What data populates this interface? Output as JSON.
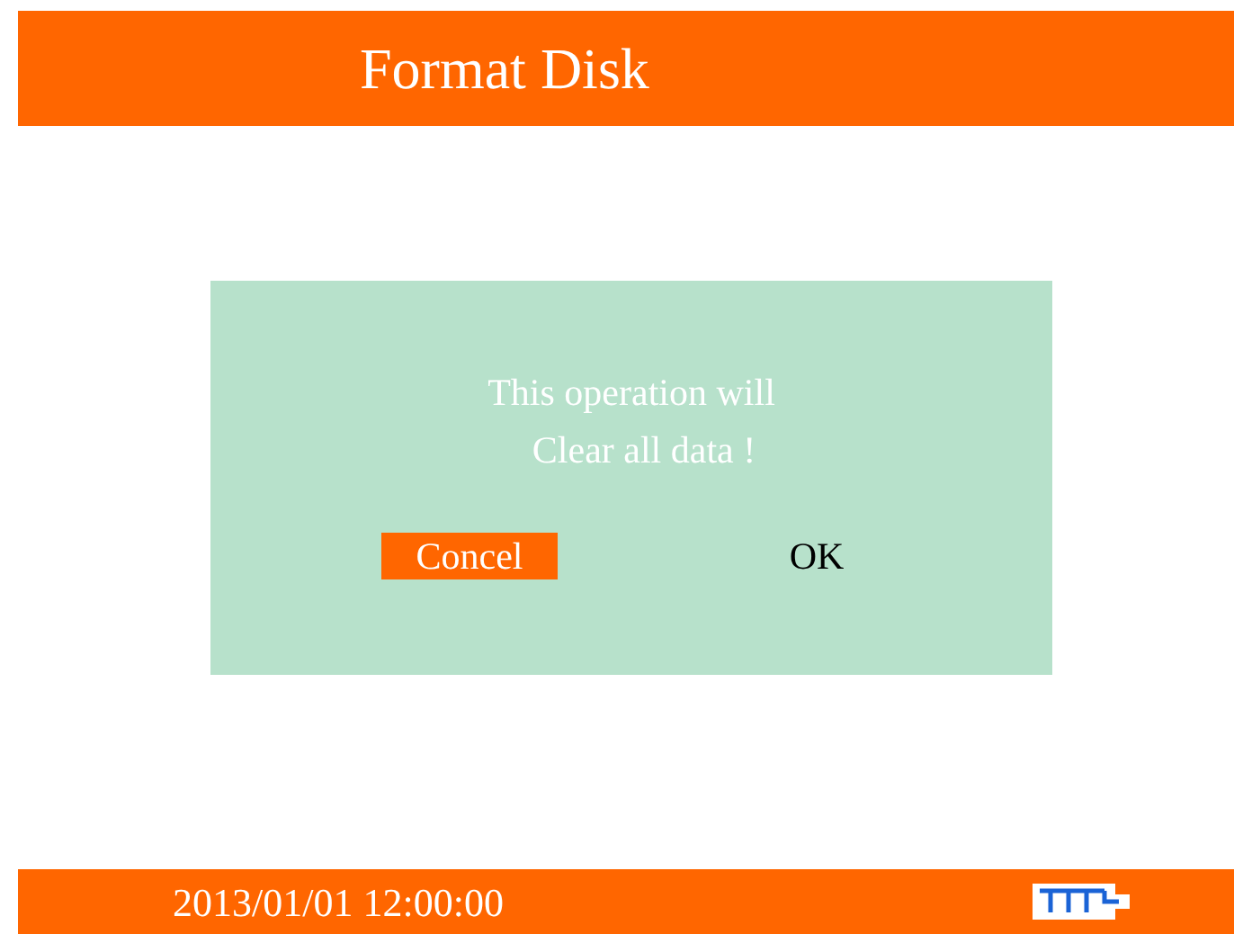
{
  "header": {
    "title": "Format Disk"
  },
  "dialog": {
    "message_lines": [
      "This operation will",
      "Clear all data !"
    ],
    "buttons": [
      {
        "label": "Concel",
        "selected": true
      },
      {
        "label": "OK",
        "selected": false
      }
    ]
  },
  "status_bar": {
    "datetime": "2013/01/01 12:00:00"
  }
}
